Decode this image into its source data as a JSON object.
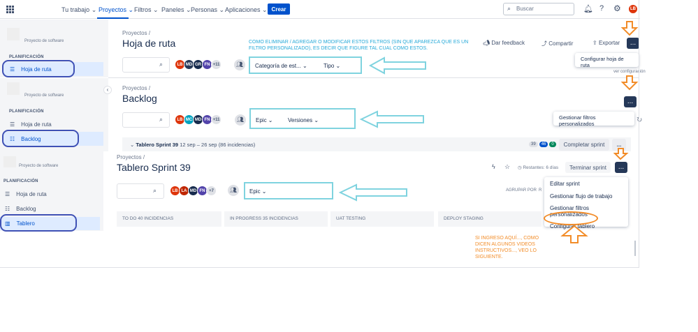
{
  "topnav": {
    "items": [
      "Tu trabajo",
      "Proyectos",
      "Filtros",
      "Paneles",
      "Personas",
      "Aplicaciones"
    ],
    "create": "Crear",
    "search_placeholder": "Buscar",
    "user_initials": "LB"
  },
  "sidebar": {
    "project_type": "Proyecto de software",
    "section": "PLANIFICACIÓN",
    "roadmap": "Hoja de ruta",
    "backlog": "Backlog",
    "board": "Tablero"
  },
  "roadmap_view": {
    "crumb": "Proyectos",
    "slash": "/",
    "title": "Hoja de ruta",
    "avatars": [
      "LB",
      "MD",
      "GR",
      "FN"
    ],
    "avatar_more": "+11",
    "filter1": "Categoría de est...",
    "filter2": "Tipo",
    "feedback": "Dar feedback",
    "share": "Compartir",
    "export": "Exportar",
    "more": "...",
    "menu_item": "Configurar hoja de ruta",
    "behind_text": "ver configuración",
    "annotation": "COMO ELIMINAR / AGREGAR O MODIFICAR ESTOS FILTROS (SIN QUE APAREZCA QUE ES UN FILTRO PERSONALIZADO), ES DECIR QUE FIGURE TAL CUAL COMO ESTOS."
  },
  "backlog_view": {
    "crumb": "Proyectos",
    "slash": "/",
    "title": "Backlog",
    "avatars": [
      "LB",
      "MC",
      "MD",
      "FN"
    ],
    "avatar_more": "+11",
    "filter1": "Epic",
    "filter2": "Versiones",
    "more": "...",
    "menu_item": "Gestionar filtros personalizados",
    "sprint_name": "Tablero Sprint 39",
    "sprint_dates": "12 sep – 26 sep",
    "sprint_count": "(86 incidencias)",
    "badge_grey": "39",
    "badge_blue": "46",
    "badge_green": "0",
    "complete_sprint": "Completar sprint"
  },
  "board_view": {
    "crumb": "Proyectos",
    "slash": "/",
    "title": "Tablero Sprint 39",
    "remaining": "Restantes: 6 días",
    "end_sprint": "Terminar sprint",
    "more": "...",
    "avatars": [
      "LB",
      "LA",
      "MD",
      "FN"
    ],
    "avatar_more": "+7",
    "filter1": "Epic",
    "group_by": "AGRUPAR POR",
    "group_by_letter": "R",
    "columns": [
      "TO DO 40 INCIDENCIAS",
      "IN PROGRESS 35 INCIDENCIAS",
      "UAT TESTING",
      "DEPLOY STAGING"
    ],
    "menu": [
      "Editar sprint",
      "Gestionar flujo de trabajo",
      "Gestionar filtros personalizados",
      "Configurar tablero"
    ],
    "annotation": "SI INGRESO AQUÍ..., COMO DICEN ALGUNOS VIDEOS INSTRUCTIVOS..., VEO LO SIGUIENTE."
  },
  "colors": {
    "brand": "#0052cc",
    "annotation_cyan": "#7fd3df",
    "annotation_orange": "#f28c28",
    "circle_blue": "#3f51b5"
  }
}
